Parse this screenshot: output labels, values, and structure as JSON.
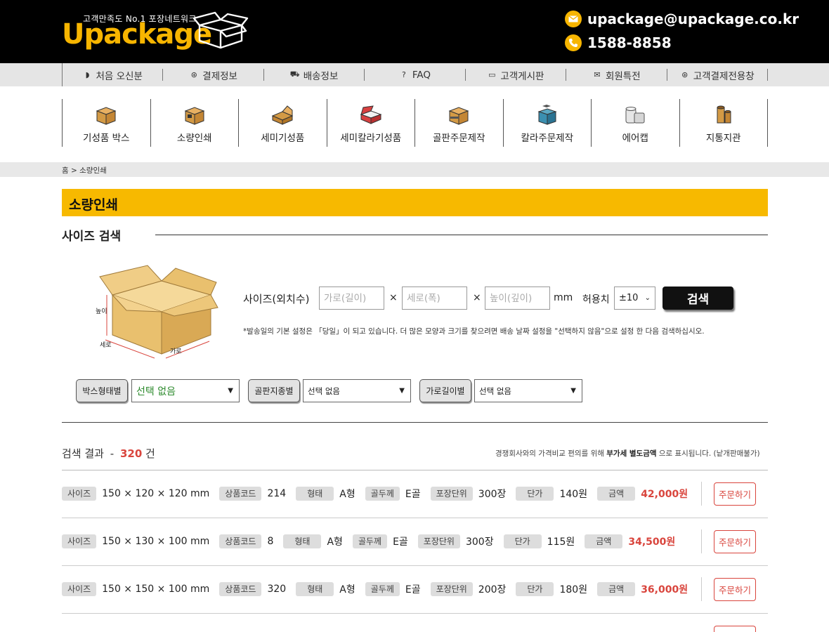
{
  "header": {
    "tagline": "고객만족도 No.1  포장네트워크",
    "logo_word": "Upackage",
    "email": "upackage@upackage.co.kr",
    "phone": "1588-8858"
  },
  "topnav": [
    {
      "label": "처음 오신분",
      "icon": "shield-icon"
    },
    {
      "label": "결제정보",
      "icon": "won-icon"
    },
    {
      "label": "배송정보",
      "icon": "truck-icon"
    },
    {
      "label": "FAQ",
      "icon": "question-icon"
    },
    {
      "label": "고객게시판",
      "icon": "chat-icon"
    },
    {
      "label": "회원특전",
      "icon": "mail-icon"
    },
    {
      "label": "고객결제전용창",
      "icon": "won-icon"
    }
  ],
  "categories": [
    {
      "label": "기성품 박스",
      "icon": "box-icon"
    },
    {
      "label": "소량인쇄",
      "icon": "printed-box-icon"
    },
    {
      "label": "세미기성품",
      "icon": "open-box-icon"
    },
    {
      "label": "세미칼라기성품",
      "icon": "color-box-icon"
    },
    {
      "label": "골판주문제작",
      "icon": "corrugated-icon"
    },
    {
      "label": "칼라주문제작",
      "icon": "color-order-icon"
    },
    {
      "label": "에어캡",
      "icon": "air-cap-icon"
    },
    {
      "label": "지통지관",
      "icon": "tube-icon"
    }
  ],
  "breadcrumb": "홈 > 소량인쇄",
  "page_title": "소량인쇄",
  "section_title": "사이즈 검색",
  "illustration": {
    "label_height": "높이",
    "label_depth": "세로",
    "label_width": "가로"
  },
  "search": {
    "size_label": "사이즈(외치수)",
    "width_placeholder": "가로(길이)",
    "depth_placeholder": "세로(폭)",
    "height_placeholder": "높이(깊이)",
    "times": "×",
    "unit": "mm",
    "tolerance_label": "허용치",
    "tolerance_value": "±10",
    "search_button": "검색",
    "notice": "*발송일의 기본 설정은 「당일」이 되고 있습니다. 더 많은 모양과 크기를 찾으려면 배송 날짜 설정을 \"선택하지 않음\"으로 설정 한 다음 검색하십시오."
  },
  "filters": [
    {
      "label": "박스형태별",
      "value": "선택 없음"
    },
    {
      "label": "골판지종별",
      "value": "선택 없음"
    },
    {
      "label": "가로길이별",
      "value": "선택 없음"
    }
  ],
  "results": {
    "label": "검색 결과",
    "dash": "-",
    "count": "320",
    "unit": "건",
    "note_prefix": "경쟁회사와의 가격비교 편의를 위해 ",
    "note_bold": "부가세 별도금액",
    "note_suffix": " 으로 표시됩니다. (낱개판매불가)"
  },
  "labels": {
    "size": "사이즈",
    "code": "상품코드",
    "type": "형태",
    "thickness": "골두께",
    "pack_unit": "포장단위",
    "unit_price": "단가",
    "amount": "금액",
    "order": "주문하기"
  },
  "rows": [
    {
      "size": "150 × 120 × 120 mm",
      "code": "214",
      "type": "A형",
      "thickness": "E골",
      "pack": "300장",
      "unit_price": "140원",
      "amount": "42,000원"
    },
    {
      "size": "150 × 130 × 100 mm",
      "code": "8",
      "type": "A형",
      "thickness": "E골",
      "pack": "300장",
      "unit_price": "115원",
      "amount": "34,500원"
    },
    {
      "size": "150 × 150 × 100 mm",
      "code": "320",
      "type": "A형",
      "thickness": "E골",
      "pack": "200장",
      "unit_price": "180원",
      "amount": "36,000원"
    }
  ],
  "colors": {
    "accent": "#f7b900",
    "price": "#d9453d",
    "header_bg": "#000000"
  }
}
